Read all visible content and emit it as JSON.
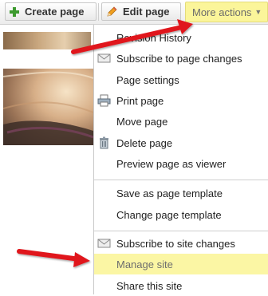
{
  "toolbar": {
    "create_page_label": "Create page",
    "edit_page_label": "Edit page",
    "more_actions_label": "More actions",
    "more_actions_caret": "▼"
  },
  "menu": {
    "group1": [
      {
        "label": "Revision History",
        "icon": ""
      },
      {
        "label": "Subscribe to page changes",
        "icon": "envelope-icon"
      },
      {
        "label": "Page settings",
        "icon": ""
      },
      {
        "label": "Print page",
        "icon": "printer-icon"
      },
      {
        "label": "Move page",
        "icon": ""
      },
      {
        "label": "Delete page",
        "icon": "trash-icon"
      },
      {
        "label": "Preview page as viewer",
        "icon": ""
      }
    ],
    "group2": [
      {
        "label": "Save as page template",
        "icon": ""
      },
      {
        "label": "Change page template",
        "icon": ""
      }
    ],
    "group3": [
      {
        "label": "Subscribe to site changes",
        "icon": "envelope-icon"
      },
      {
        "label": "Manage site",
        "icon": "",
        "highlighted": true
      },
      {
        "label": "Share this site",
        "icon": ""
      }
    ]
  },
  "colors": {
    "highlight": "#fbf6a4",
    "arrow": "#e0191f",
    "plus_green": "#3d9a2f"
  }
}
